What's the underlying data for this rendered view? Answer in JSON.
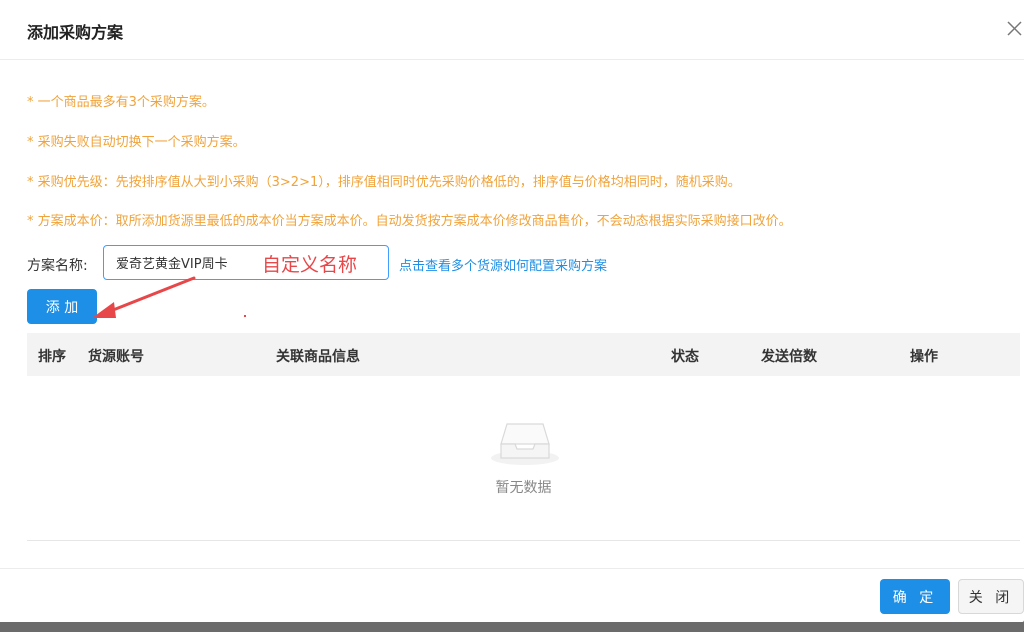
{
  "dialog": {
    "title": "添加采购方案"
  },
  "tips": [
    "* 一个商品最多有3个采购方案。",
    "* 采购失败自动切换下一个采购方案。",
    "* 采购优先级：先按排序值从大到小采购（3>2>1），排序值相同时优先采购价格低的，排序值与价格均相同时，随机采购。",
    "* 方案成本价：取所添加货源里最低的成本价当方案成本价。自动发货按方案成本价修改商品售价，不会动态根据实际采购接口改价。"
  ],
  "form": {
    "name_label": "方案名称:",
    "name_value": "爱奇艺黄金VIP周卡",
    "config_link": "点击查看多个货源如何配置采购方案",
    "add_button": "添 加"
  },
  "annotation": {
    "text": "自定义名称",
    "color": "#e8474a"
  },
  "table": {
    "columns": [
      "排序",
      "货源账号",
      "关联商品信息",
      "状态",
      "发送倍数",
      "操作"
    ],
    "rows": [],
    "empty_text": "暂无数据"
  },
  "footer": {
    "ok_button": "确 定",
    "close_button": "关 闭"
  },
  "icons": {
    "close": "close-icon",
    "empty": "empty-box-icon"
  },
  "colors": {
    "primary": "#1e8fe6",
    "tip": "#f0a33b",
    "annotation": "#e8474a"
  }
}
